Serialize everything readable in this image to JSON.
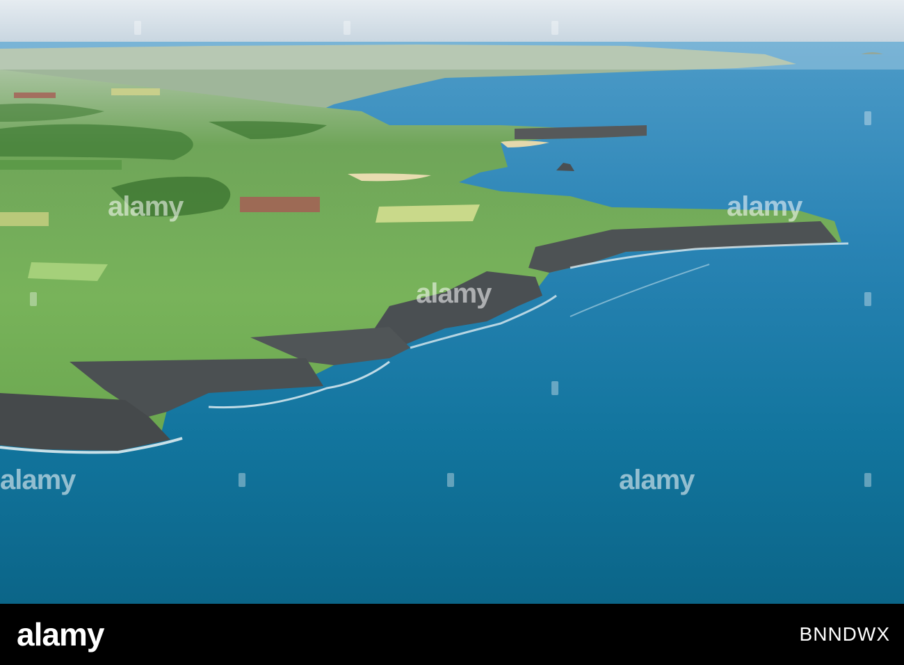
{
  "photo": {
    "colors": {
      "sky": "#dfe6ec",
      "horizon_haze": "#b9c9d6",
      "sea_far": "#3f93c2",
      "sea_near": "#0d6a8f",
      "grass_light": "#7fb85a",
      "grass_dark": "#3e7a33",
      "cliff": "#4a4f52",
      "surf": "#e9f3f6"
    }
  },
  "watermark": {
    "text": "alamy"
  },
  "footer": {
    "logo_text": "alamy",
    "image_id": "BNNDWX",
    "background": "#000000"
  }
}
